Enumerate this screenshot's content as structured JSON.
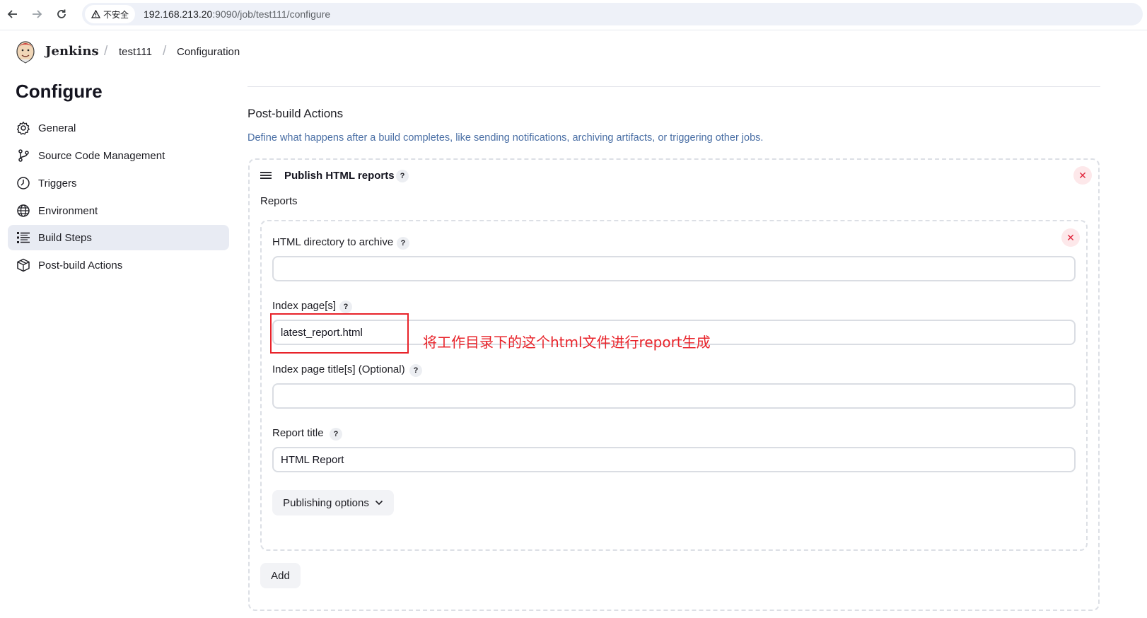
{
  "browser": {
    "security_label": "不安全",
    "url_host": "192.168.213.20",
    "url_path": ":9090/job/test111/configure"
  },
  "header": {
    "app_name": "Jenkins",
    "breadcrumbs": [
      "test111",
      "Configuration"
    ]
  },
  "sidebar": {
    "title": "Configure",
    "items": [
      {
        "label": "General",
        "icon": "gear-icon"
      },
      {
        "label": "Source Code Management",
        "icon": "branch-icon"
      },
      {
        "label": "Triggers",
        "icon": "clock-icon"
      },
      {
        "label": "Environment",
        "icon": "globe-icon"
      },
      {
        "label": "Build Steps",
        "icon": "list-icon",
        "active": true
      },
      {
        "label": "Post-build Actions",
        "icon": "package-icon"
      }
    ]
  },
  "main": {
    "section_title": "Post-build Actions",
    "section_description": "Define what happens after a build completes, like sending notifications, archiving artifacts, or triggering other jobs.",
    "step": {
      "title": "Publish HTML reports",
      "reports_label": "Reports",
      "fields": [
        {
          "label": "HTML directory to archive",
          "value": ""
        },
        {
          "label": "Index page[s]",
          "value": "latest_report.html"
        },
        {
          "label": "Index page title[s] (Optional)",
          "value": ""
        },
        {
          "label": "Report title",
          "value": "HTML Report"
        }
      ],
      "publishing_options_label": "Publishing options",
      "add_label": "Add"
    }
  },
  "annotation": {
    "text": "将工作目录下的这个html文件进行report生成",
    "color": "#e8232a"
  },
  "help_glyph": "?",
  "close_glyph": "✕"
}
